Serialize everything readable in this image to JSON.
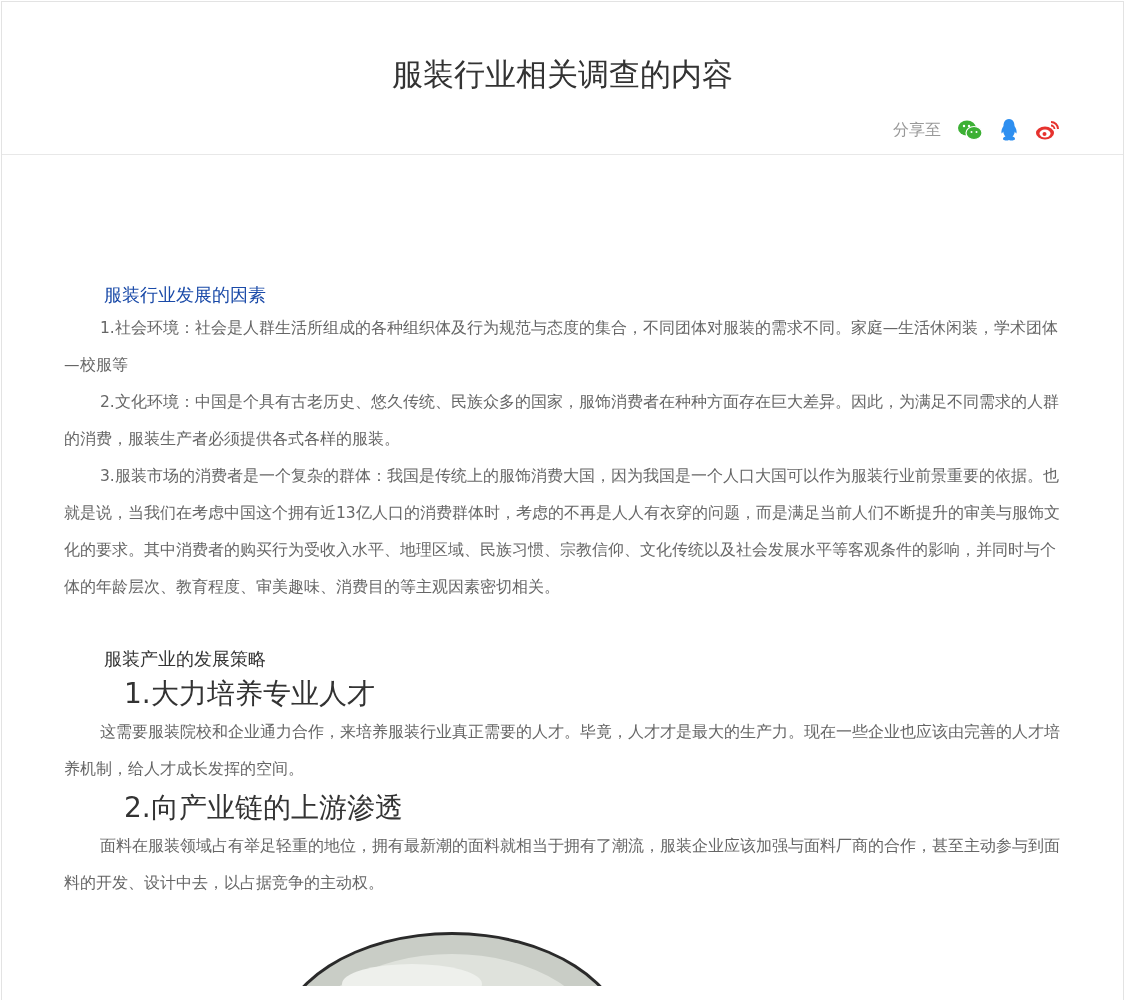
{
  "title": "服装行业相关调查的内容",
  "share": {
    "label": "分享至",
    "targets": [
      {
        "kind": "wechat"
      },
      {
        "kind": "qq"
      },
      {
        "kind": "weibo"
      }
    ]
  },
  "content": [
    {
      "kind": "spacer"
    },
    {
      "kind": "section_heading",
      "text": "服装行业发展的因素",
      "accent": true
    },
    {
      "kind": "paragraph",
      "text": "1.社会环境：社会是人群生活所组成的各种组织体及行为规范与态度的集合，不同团体对服装的需求不同。家庭—生活休闲装，学术团体—校服等"
    },
    {
      "kind": "paragraph",
      "text": "2.文化环境：中国是个具有古老历史、悠久传统、民族众多的国家，服饰消费者在种种方面存在巨大差异。因此，为满足不同需求的人群的消费，服装生产者必须提供各式各样的服装。"
    },
    {
      "kind": "paragraph",
      "text": "3.服装市场的消费者是一个复杂的群体：我国是传统上的服饰消费大国，因为我国是一个人口大国可以作为服装行业前景重要的依据。也就是说，当我们在考虑中国这个拥有近13亿人口的消费群体时，考虑的不再是人人有衣穿的问题，而是满足当前人们不断提升的审美与服饰文化的要求。其中消费者的购买行为受收入水平、地理区域、民族习惯、宗教信仰、文化传统以及社会发展水平等客观条件的影响，并同时与个体的年龄层次、教育程度、审美趣味、消费目的等主观因素密切相关。"
    },
    {
      "kind": "gap"
    },
    {
      "kind": "section_heading",
      "text": "服装产业的发展策略",
      "accent": false
    },
    {
      "kind": "big_heading",
      "text": "1.大力培养专业人才"
    },
    {
      "kind": "paragraph",
      "text": "这需要服装院校和企业通力合作，来培养服装行业真正需要的人才。毕竟，人才才是最大的生产力。现在一些企业也应该由完善的人才培养机制，给人才成长发挥的空间。"
    },
    {
      "kind": "big_heading",
      "text": "2.向产业链的上游渗透"
    },
    {
      "kind": "paragraph",
      "text": "面料在服装领域占有举足轻重的地位，拥有最新潮的面料就相当于拥有了潮流，服装企业应该加强与面料厂商的合作，甚至主动参与到面料的开发、设计中去，以占据竞争的主动权。"
    },
    {
      "kind": "picture"
    }
  ]
}
